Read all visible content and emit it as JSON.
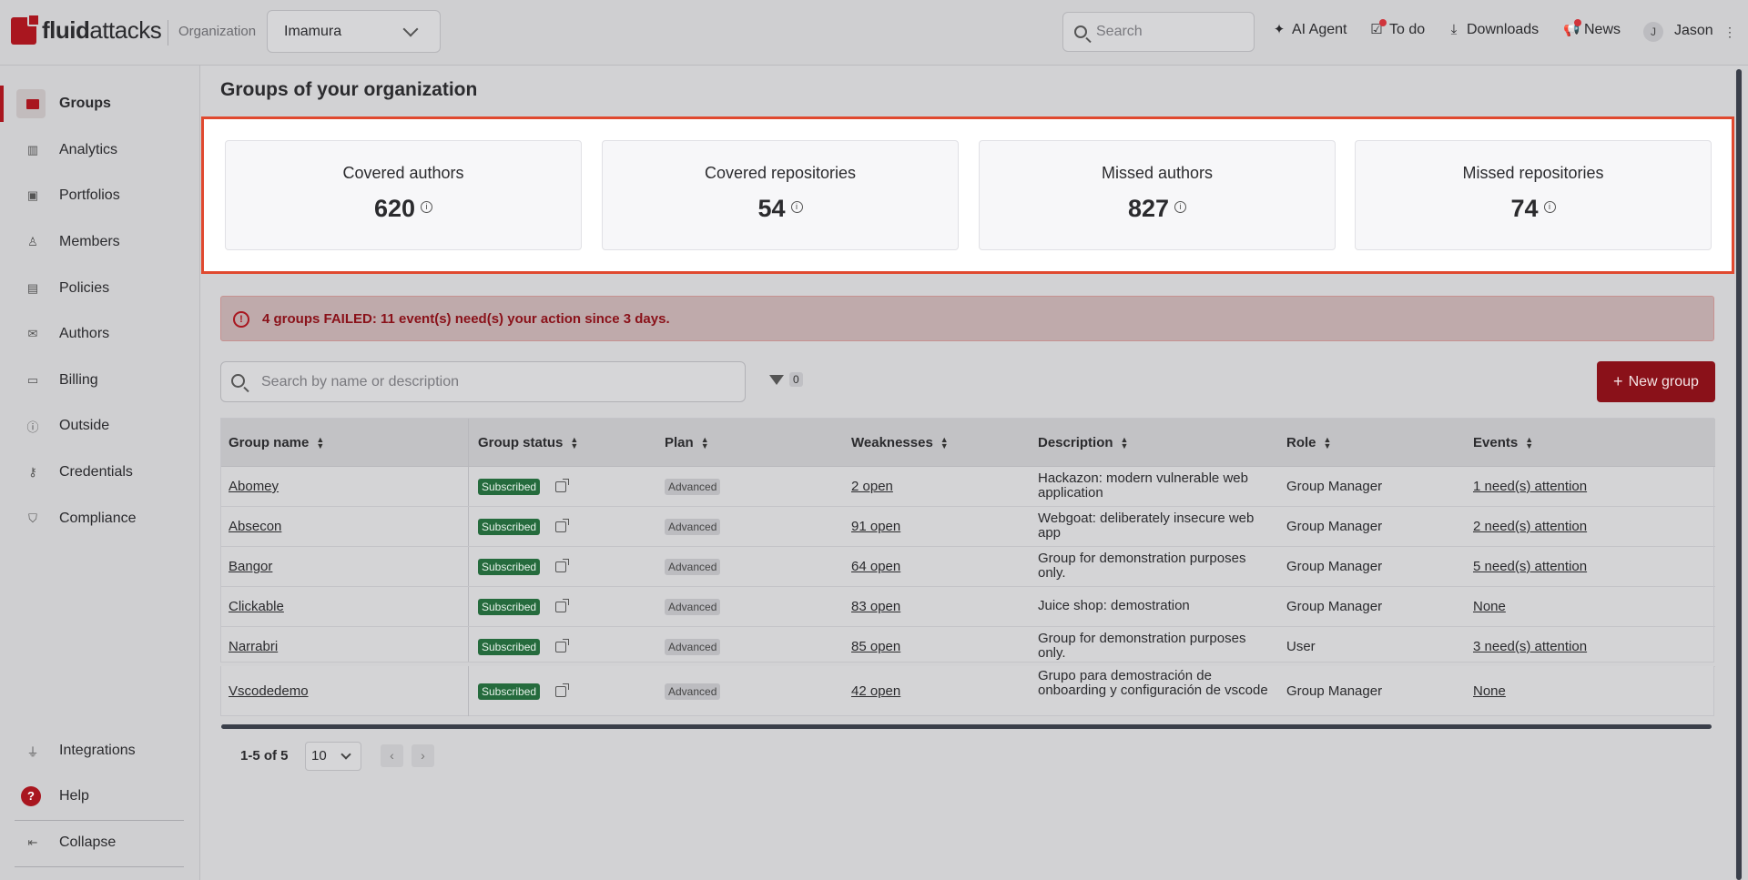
{
  "app": {
    "logo_text_a": "fluid",
    "logo_text_b": "attacks"
  },
  "header": {
    "org_label": "Organization",
    "org_value": "Imamura",
    "search_placeholder": "Search",
    "actions": [
      {
        "label": "AI Agent",
        "icon": "sparkle-icon"
      },
      {
        "label": "To do",
        "icon": "checklist-icon"
      },
      {
        "label": "Downloads",
        "icon": "download-icon"
      },
      {
        "label": "News",
        "icon": "megaphone-icon"
      }
    ],
    "user_initial": "J",
    "user_name": "Jason",
    "menu_glyph": "⋮"
  },
  "sidebar": {
    "items": [
      {
        "label": "Groups",
        "icon": "folder-icon",
        "active": true
      },
      {
        "label": "Analytics",
        "icon": "bar-chart-icon"
      },
      {
        "label": "Portfolios",
        "icon": "briefcase-icon"
      },
      {
        "label": "Members",
        "icon": "add-user-icon"
      },
      {
        "label": "Policies",
        "icon": "policy-icon"
      },
      {
        "label": "Authors",
        "icon": "mail-icon"
      },
      {
        "label": "Billing",
        "icon": "card-icon"
      },
      {
        "label": "Outside",
        "icon": "info-icon"
      },
      {
        "label": "Credentials",
        "icon": "key-icon"
      },
      {
        "label": "Compliance",
        "icon": "shield-icon"
      }
    ],
    "bottom": [
      {
        "label": "Integrations",
        "icon": "plug-icon"
      },
      {
        "label": "Help",
        "icon": "help-icon"
      },
      {
        "label": "Collapse",
        "icon": "collapse-icon"
      }
    ]
  },
  "main": {
    "title": "Groups of your organization",
    "stats": [
      {
        "label": "Covered authors",
        "value": "620"
      },
      {
        "label": "Covered repositories",
        "value": "54"
      },
      {
        "label": "Missed authors",
        "value": "827"
      },
      {
        "label": "Missed repositories",
        "value": "74"
      }
    ],
    "alert": "4 groups FAILED: 11 event(s) need(s) your action since 3 days.",
    "table_search_placeholder": "Search by name or description",
    "filter_count": "0",
    "new_group_label": "New group",
    "columns": [
      "Group name",
      "Group status",
      "Plan",
      "Weaknesses",
      "Description",
      "Role",
      "Events"
    ],
    "rows": [
      {
        "name": "Abomey",
        "status": "Subscribed",
        "plan": "Advanced",
        "weaknesses": "2 open",
        "description": "Hackazon: modern vulnerable web application",
        "role": "Group Manager",
        "events": "1 need(s) attention"
      },
      {
        "name": "Absecon",
        "status": "Subscribed",
        "plan": "Advanced",
        "weaknesses": "91 open",
        "description": "Webgoat: deliberately insecure web app",
        "role": "Group Manager",
        "events": "2 need(s) attention"
      },
      {
        "name": "Bangor",
        "status": "Subscribed",
        "plan": "Advanced",
        "weaknesses": "64 open",
        "description": "Group for demonstration purposes only.",
        "role": "Group Manager",
        "events": "5 need(s) attention"
      },
      {
        "name": "Clickable",
        "status": "Subscribed",
        "plan": "Advanced",
        "weaknesses": "83 open",
        "description": "Juice shop: demostration",
        "role": "Group Manager",
        "events": "None"
      },
      {
        "name": "Narrabri",
        "status": "Subscribed",
        "plan": "Advanced",
        "weaknesses": "85 open",
        "description": "Group for demonstration purposes only.",
        "role": "User",
        "events": "3 need(s) attention"
      },
      {
        "name": "Vscodedemo",
        "status": "Subscribed",
        "plan": "Advanced",
        "weaknesses": "42 open",
        "description": "Grupo para demostración de onboarding y configuración de vscode",
        "role": "Group Manager",
        "events": "None"
      }
    ],
    "pagination": {
      "range": "1-5 of 5",
      "page_size": "10"
    }
  },
  "colors": {
    "brand": "#a9161f",
    "subscribed": "#256b3d",
    "highlight_border": "#e0492f"
  }
}
